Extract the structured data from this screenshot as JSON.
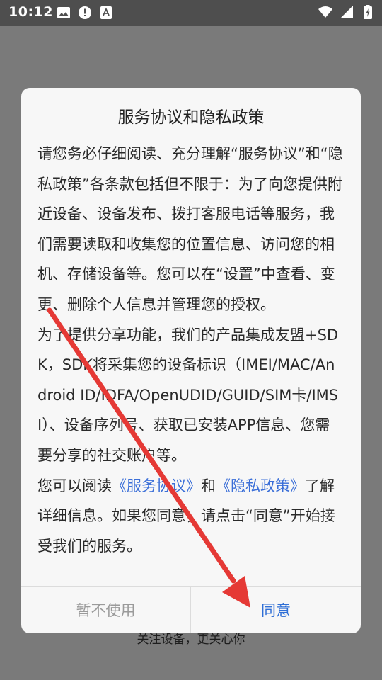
{
  "status_bar": {
    "time": "10:12",
    "left_icons": [
      "image-icon",
      "alert-icon",
      "text-badge-icon"
    ],
    "right_icons": [
      "wifi-icon",
      "signal-icon",
      "battery-charging-icon"
    ]
  },
  "background": {
    "footer_text": "关注设备，更关心你"
  },
  "dialog": {
    "title": "服务协议和隐私政策",
    "paragraph1": "请您务必仔细阅读、充分理解“服务协议”和“隐私政策”各条款包括但不限于：为了向您提供附近设备、设备发布、拨打客服电话等服务，我们需要读取和收集您的位置信息、访问您的相机、存储设备等。您可以在“设置”中查看、变更、删除个人信息并管理您的授权。",
    "paragraph2": "为了提供分享功能，我们的产品集成友盟+SDK，SDK将采集您的设备标识（IMEI/MAC/Android ID/IDFA/OpenUDID/GUID/SIM卡/IMSI）、设备序列号、获取已安装APP信息、您需要分享的社交账户等。",
    "p3_prefix": "您可以阅读",
    "link_terms": "《服务协议》",
    "p3_and": "和",
    "link_privacy": "《隐私政策》",
    "p3_suffix": "了解详细信息。如果您同意，请点击“同意”开始接受我们的服务。",
    "decline_label": "暂不使用",
    "agree_label": "同意"
  },
  "colors": {
    "accent": "#2f6fd6",
    "arrow": "#e53935",
    "scrim": "#7a7a7a"
  }
}
